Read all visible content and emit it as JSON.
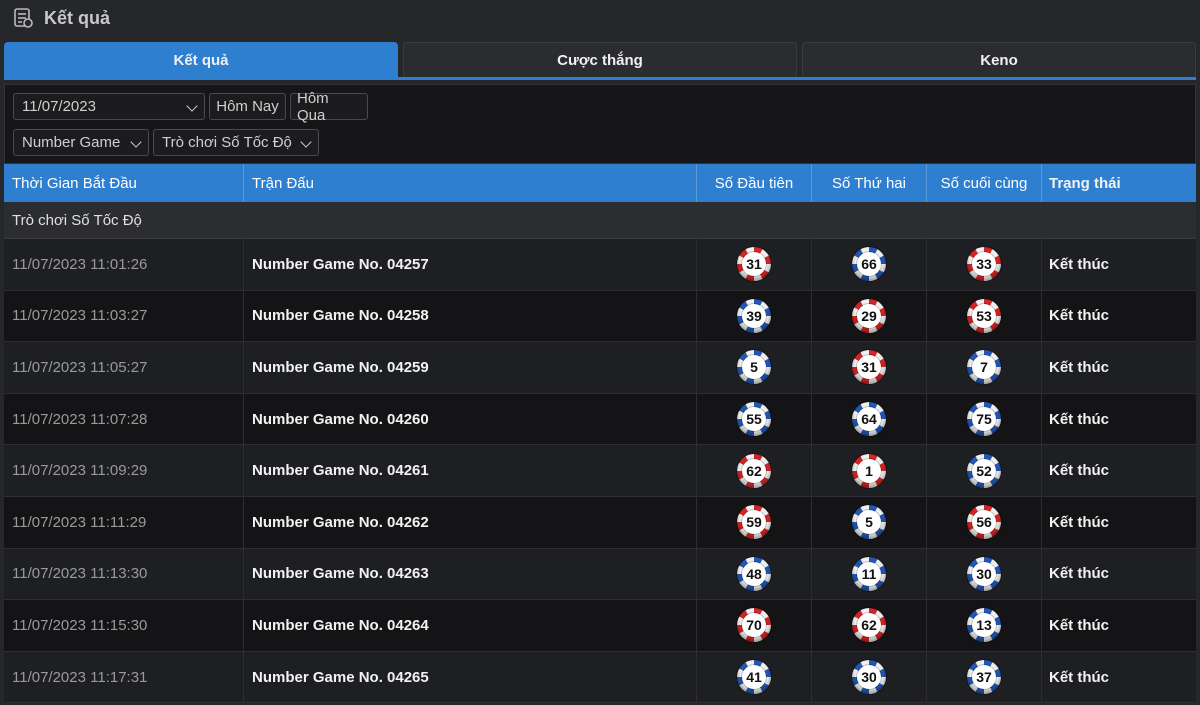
{
  "window": {
    "title": "Kết quả"
  },
  "tabs": [
    {
      "label": "Kết quả",
      "active": true
    },
    {
      "label": "Cược thắng",
      "active": false
    },
    {
      "label": "Keno",
      "active": false
    }
  ],
  "filters": {
    "date": "11/07/2023",
    "today": "Hôm Nay",
    "yesterday": "Hôm Qua",
    "game_type": "Number Game",
    "game_mode": "Trò chơi Số Tốc Độ"
  },
  "table": {
    "headers": [
      "Thời Gian Bắt Đầu",
      "Trận Đấu",
      "Số Đầu tiên",
      "Số Thứ hai",
      "Số cuối cùng",
      "Trạng thái"
    ],
    "group": "Trò chơi Số Tốc Độ",
    "rows": [
      {
        "time": "11/07/2023 11:01:26",
        "match": "Number Game No. 04257",
        "n1": "31",
        "c1": "red",
        "n2": "66",
        "c2": "blue",
        "n3": "33",
        "c3": "red",
        "status": "Kết thúc"
      },
      {
        "time": "11/07/2023 11:03:27",
        "match": "Number Game No. 04258",
        "n1": "39",
        "c1": "blue",
        "n2": "29",
        "c2": "red",
        "n3": "53",
        "c3": "red",
        "status": "Kết thúc"
      },
      {
        "time": "11/07/2023 11:05:27",
        "match": "Number Game No. 04259",
        "n1": "5",
        "c1": "blue",
        "n2": "31",
        "c2": "red",
        "n3": "7",
        "c3": "blue",
        "status": "Kết thúc"
      },
      {
        "time": "11/07/2023 11:07:28",
        "match": "Number Game No. 04260",
        "n1": "55",
        "c1": "blue",
        "n2": "64",
        "c2": "blue",
        "n3": "75",
        "c3": "blue",
        "status": "Kết thúc"
      },
      {
        "time": "11/07/2023 11:09:29",
        "match": "Number Game No. 04261",
        "n1": "62",
        "c1": "red",
        "n2": "1",
        "c2": "red",
        "n3": "52",
        "c3": "blue",
        "status": "Kết thúc"
      },
      {
        "time": "11/07/2023 11:11:29",
        "match": "Number Game No. 04262",
        "n1": "59",
        "c1": "red",
        "n2": "5",
        "c2": "blue",
        "n3": "56",
        "c3": "red",
        "status": "Kết thúc"
      },
      {
        "time": "11/07/2023 11:13:30",
        "match": "Number Game No. 04263",
        "n1": "48",
        "c1": "blue",
        "n2": "11",
        "c2": "blue",
        "n3": "30",
        "c3": "blue",
        "status": "Kết thúc"
      },
      {
        "time": "11/07/2023 11:15:30",
        "match": "Number Game No. 04264",
        "n1": "70",
        "c1": "red",
        "n2": "62",
        "c2": "red",
        "n3": "13",
        "c3": "blue",
        "status": "Kết thúc"
      },
      {
        "time": "11/07/2023 11:17:31",
        "match": "Number Game No. 04265",
        "n1": "41",
        "c1": "blue",
        "n2": "30",
        "c2": "blue",
        "n3": "37",
        "c3": "blue",
        "status": "Kết thúc"
      }
    ]
  },
  "colors": {
    "accent": "#2f7fd0",
    "red_ball": "#d42626",
    "blue_ball": "#2358b5",
    "background": "#26272b"
  },
  "icons": {
    "title": "results-list-icon",
    "dropdown": "chevron-down-icon"
  }
}
